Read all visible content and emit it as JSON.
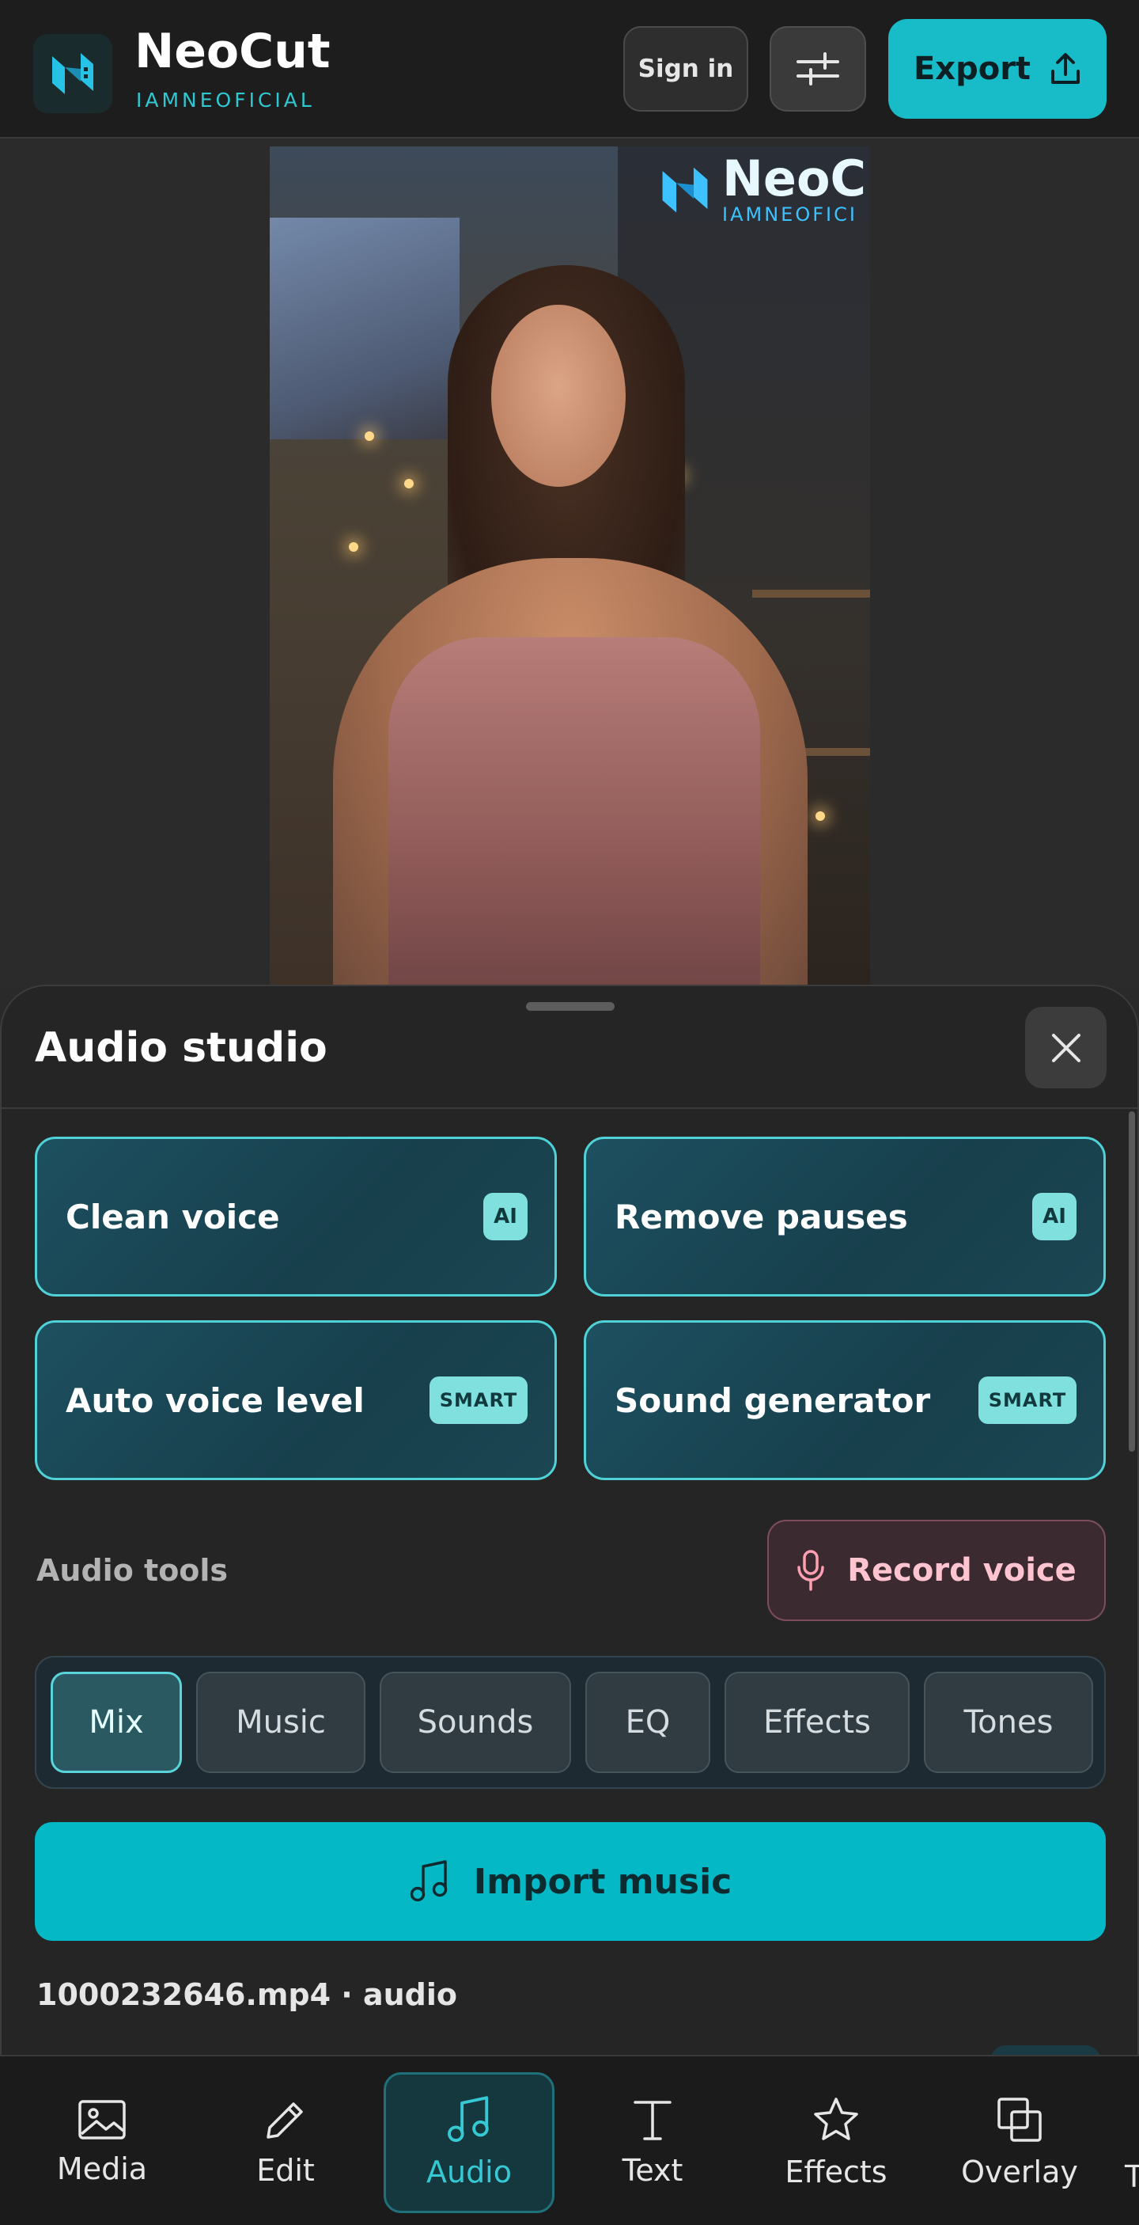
{
  "header": {
    "brand_name": "NeoCut",
    "brand_sub": "IAMNEOFICIAL",
    "signin_label": "Sign in",
    "settings_icon": "sliders-icon",
    "export_label": "Export",
    "export_icon": "upload-icon"
  },
  "preview": {
    "watermark_title": "NeoC",
    "watermark_sub": "IAMNEOFICI"
  },
  "panel": {
    "title": "Audio studio",
    "close_icon": "close-icon",
    "cards": [
      {
        "label": "Clean voice",
        "badge": "AI"
      },
      {
        "label": "Remove pauses",
        "badge": "AI"
      },
      {
        "label": "Auto voice level",
        "badge": "SMART"
      },
      {
        "label": "Sound generator",
        "badge": "SMART"
      }
    ],
    "tools_label": "Audio tools",
    "record_label": "Record voice",
    "tabs": [
      "Mix",
      "Music",
      "Sounds",
      "EQ",
      "Effects",
      "Tones"
    ],
    "active_tab": "Mix",
    "import_label": "Import music",
    "file_name": "1000232646.mp4 · audio"
  },
  "bottom_nav": {
    "items": [
      {
        "label": "Media",
        "icon": "image-icon"
      },
      {
        "label": "Edit",
        "icon": "pencil-icon"
      },
      {
        "label": "Audio",
        "icon": "music-note-icon"
      },
      {
        "label": "Text",
        "icon": "text-icon"
      },
      {
        "label": "Effects",
        "icon": "star-icon"
      },
      {
        "label": "Overlay",
        "icon": "overlay-icon"
      }
    ],
    "active": "Audio",
    "overflow_text": "T"
  },
  "colors": {
    "accent": "#17bcc8",
    "card_border": "#4fd1d6",
    "record_text": "#ffc4cf",
    "background": "#2a2a2a"
  }
}
